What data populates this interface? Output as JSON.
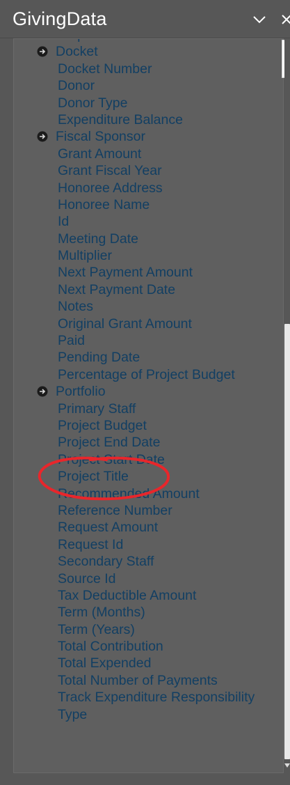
{
  "header": {
    "title": "GivingData",
    "collapse_icon": "chevron-down-icon",
    "close_icon": "close-icon"
  },
  "colors": {
    "background": "#575757",
    "panel": "#5f5f5f",
    "field_text": "#123f63",
    "annotation_circle": "#e8262b"
  },
  "fields": [
    {
      "label": "Disposition Date",
      "group": false
    },
    {
      "label": "Docket",
      "group": true
    },
    {
      "label": "Docket Number",
      "group": false
    },
    {
      "label": "Donor",
      "group": false
    },
    {
      "label": "Donor Type",
      "group": false
    },
    {
      "label": "Expenditure Balance",
      "group": false
    },
    {
      "label": "Fiscal Sponsor",
      "group": true
    },
    {
      "label": "Grant Amount",
      "group": false
    },
    {
      "label": "Grant Fiscal Year",
      "group": false
    },
    {
      "label": "Honoree Address",
      "group": false
    },
    {
      "label": "Honoree Name",
      "group": false
    },
    {
      "label": "Id",
      "group": false
    },
    {
      "label": "Meeting Date",
      "group": false
    },
    {
      "label": "Multiplier",
      "group": false
    },
    {
      "label": "Next Payment Amount",
      "group": false
    },
    {
      "label": "Next Payment Date",
      "group": false
    },
    {
      "label": "Notes",
      "group": false
    },
    {
      "label": "Original Grant Amount",
      "group": false
    },
    {
      "label": "Paid",
      "group": false
    },
    {
      "label": "Pending Date",
      "group": false
    },
    {
      "label": "Percentage of Project Budget",
      "group": false
    },
    {
      "label": "Portfolio",
      "group": true
    },
    {
      "label": "Primary Staff",
      "group": false
    },
    {
      "label": "Project Budget",
      "group": false
    },
    {
      "label": "Project End Date",
      "group": false
    },
    {
      "label": "Project Start Date",
      "group": false
    },
    {
      "label": "Project Title",
      "group": false
    },
    {
      "label": "Recommended Amount",
      "group": false
    },
    {
      "label": "Reference Number",
      "group": false
    },
    {
      "label": "Request Amount",
      "group": false
    },
    {
      "label": "Request Id",
      "group": false
    },
    {
      "label": "Secondary Staff",
      "group": false
    },
    {
      "label": "Source Id",
      "group": false
    },
    {
      "label": "Tax Deductible Amount",
      "group": false
    },
    {
      "label": "Term (Months)",
      "group": false
    },
    {
      "label": "Term (Years)",
      "group": false
    },
    {
      "label": "Total Contribution",
      "group": false
    },
    {
      "label": "Total Expended",
      "group": false
    },
    {
      "label": "Total Number of Payments",
      "group": false
    },
    {
      "label": "Track Expenditure Responsibility",
      "group": false
    },
    {
      "label": "Type",
      "group": false
    }
  ],
  "scrollbar": {
    "position_fraction": 0.4,
    "visible_fraction": 0.6
  }
}
